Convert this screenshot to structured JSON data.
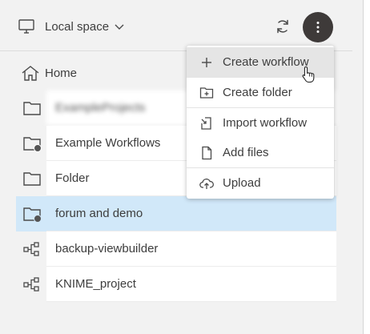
{
  "header": {
    "space_label": "Local space",
    "icons": {
      "space": "monitor-icon",
      "dropdown": "chevron-down-icon",
      "sync": "sync-icon",
      "more": "more-vertical-icon"
    }
  },
  "list": {
    "home_label": "Home",
    "items": [
      {
        "label": "ExampleProjects",
        "icon": "folder-icon",
        "blurred": true
      },
      {
        "label": "Example Workflows",
        "icon": "folder-with-badge-icon"
      },
      {
        "label": "Folder",
        "icon": "folder-icon"
      },
      {
        "label": "forum and demo",
        "icon": "folder-with-badge-icon",
        "selected": true
      },
      {
        "label": "backup-viewbuilder",
        "icon": "workflow-icon"
      },
      {
        "label": "KNIME_project",
        "icon": "workflow-icon"
      }
    ]
  },
  "menu": {
    "items": [
      {
        "label": "Create workflow",
        "icon": "plus-icon",
        "hover": true
      },
      {
        "label": "Create folder",
        "icon": "folder-plus-icon"
      },
      {
        "label": "Import workflow",
        "icon": "import-icon"
      },
      {
        "label": "Add files",
        "icon": "file-icon"
      },
      {
        "label": "Upload",
        "icon": "cloud-upload-icon"
      }
    ]
  },
  "colors": {
    "background": "#f2f2f2",
    "selected_row": "#d1e8f9",
    "menu_button": "#3e3a39",
    "menu_hover": "#e5e5e5",
    "text": "#3d3d3d"
  }
}
